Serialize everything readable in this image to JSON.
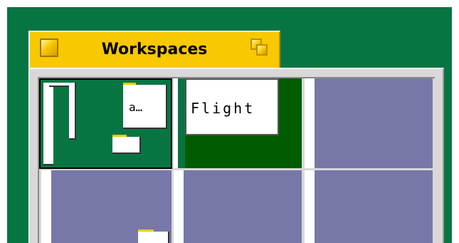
{
  "window": {
    "title": "Workspaces"
  },
  "workspaces": [
    {
      "id": "ws-1",
      "current": true,
      "windows": [
        "a…"
      ]
    },
    {
      "id": "ws-2",
      "current": false,
      "windows": [
        "Flight"
      ]
    },
    {
      "id": "ws-3",
      "current": false,
      "windows": []
    },
    {
      "id": "ws-4",
      "current": false,
      "windows": []
    },
    {
      "id": "ws-5",
      "current": false,
      "windows": []
    },
    {
      "id": "ws-6",
      "current": false,
      "windows": []
    }
  ],
  "icons": {
    "close": "close-box-icon",
    "zoom": "zoom-box-icon"
  },
  "colors": {
    "desktop": "#077542",
    "empty_workspace": "#7778a8",
    "title_tab": "#f8c800",
    "frame": "#d8d8d8",
    "dark_green_window": "#005c00"
  }
}
